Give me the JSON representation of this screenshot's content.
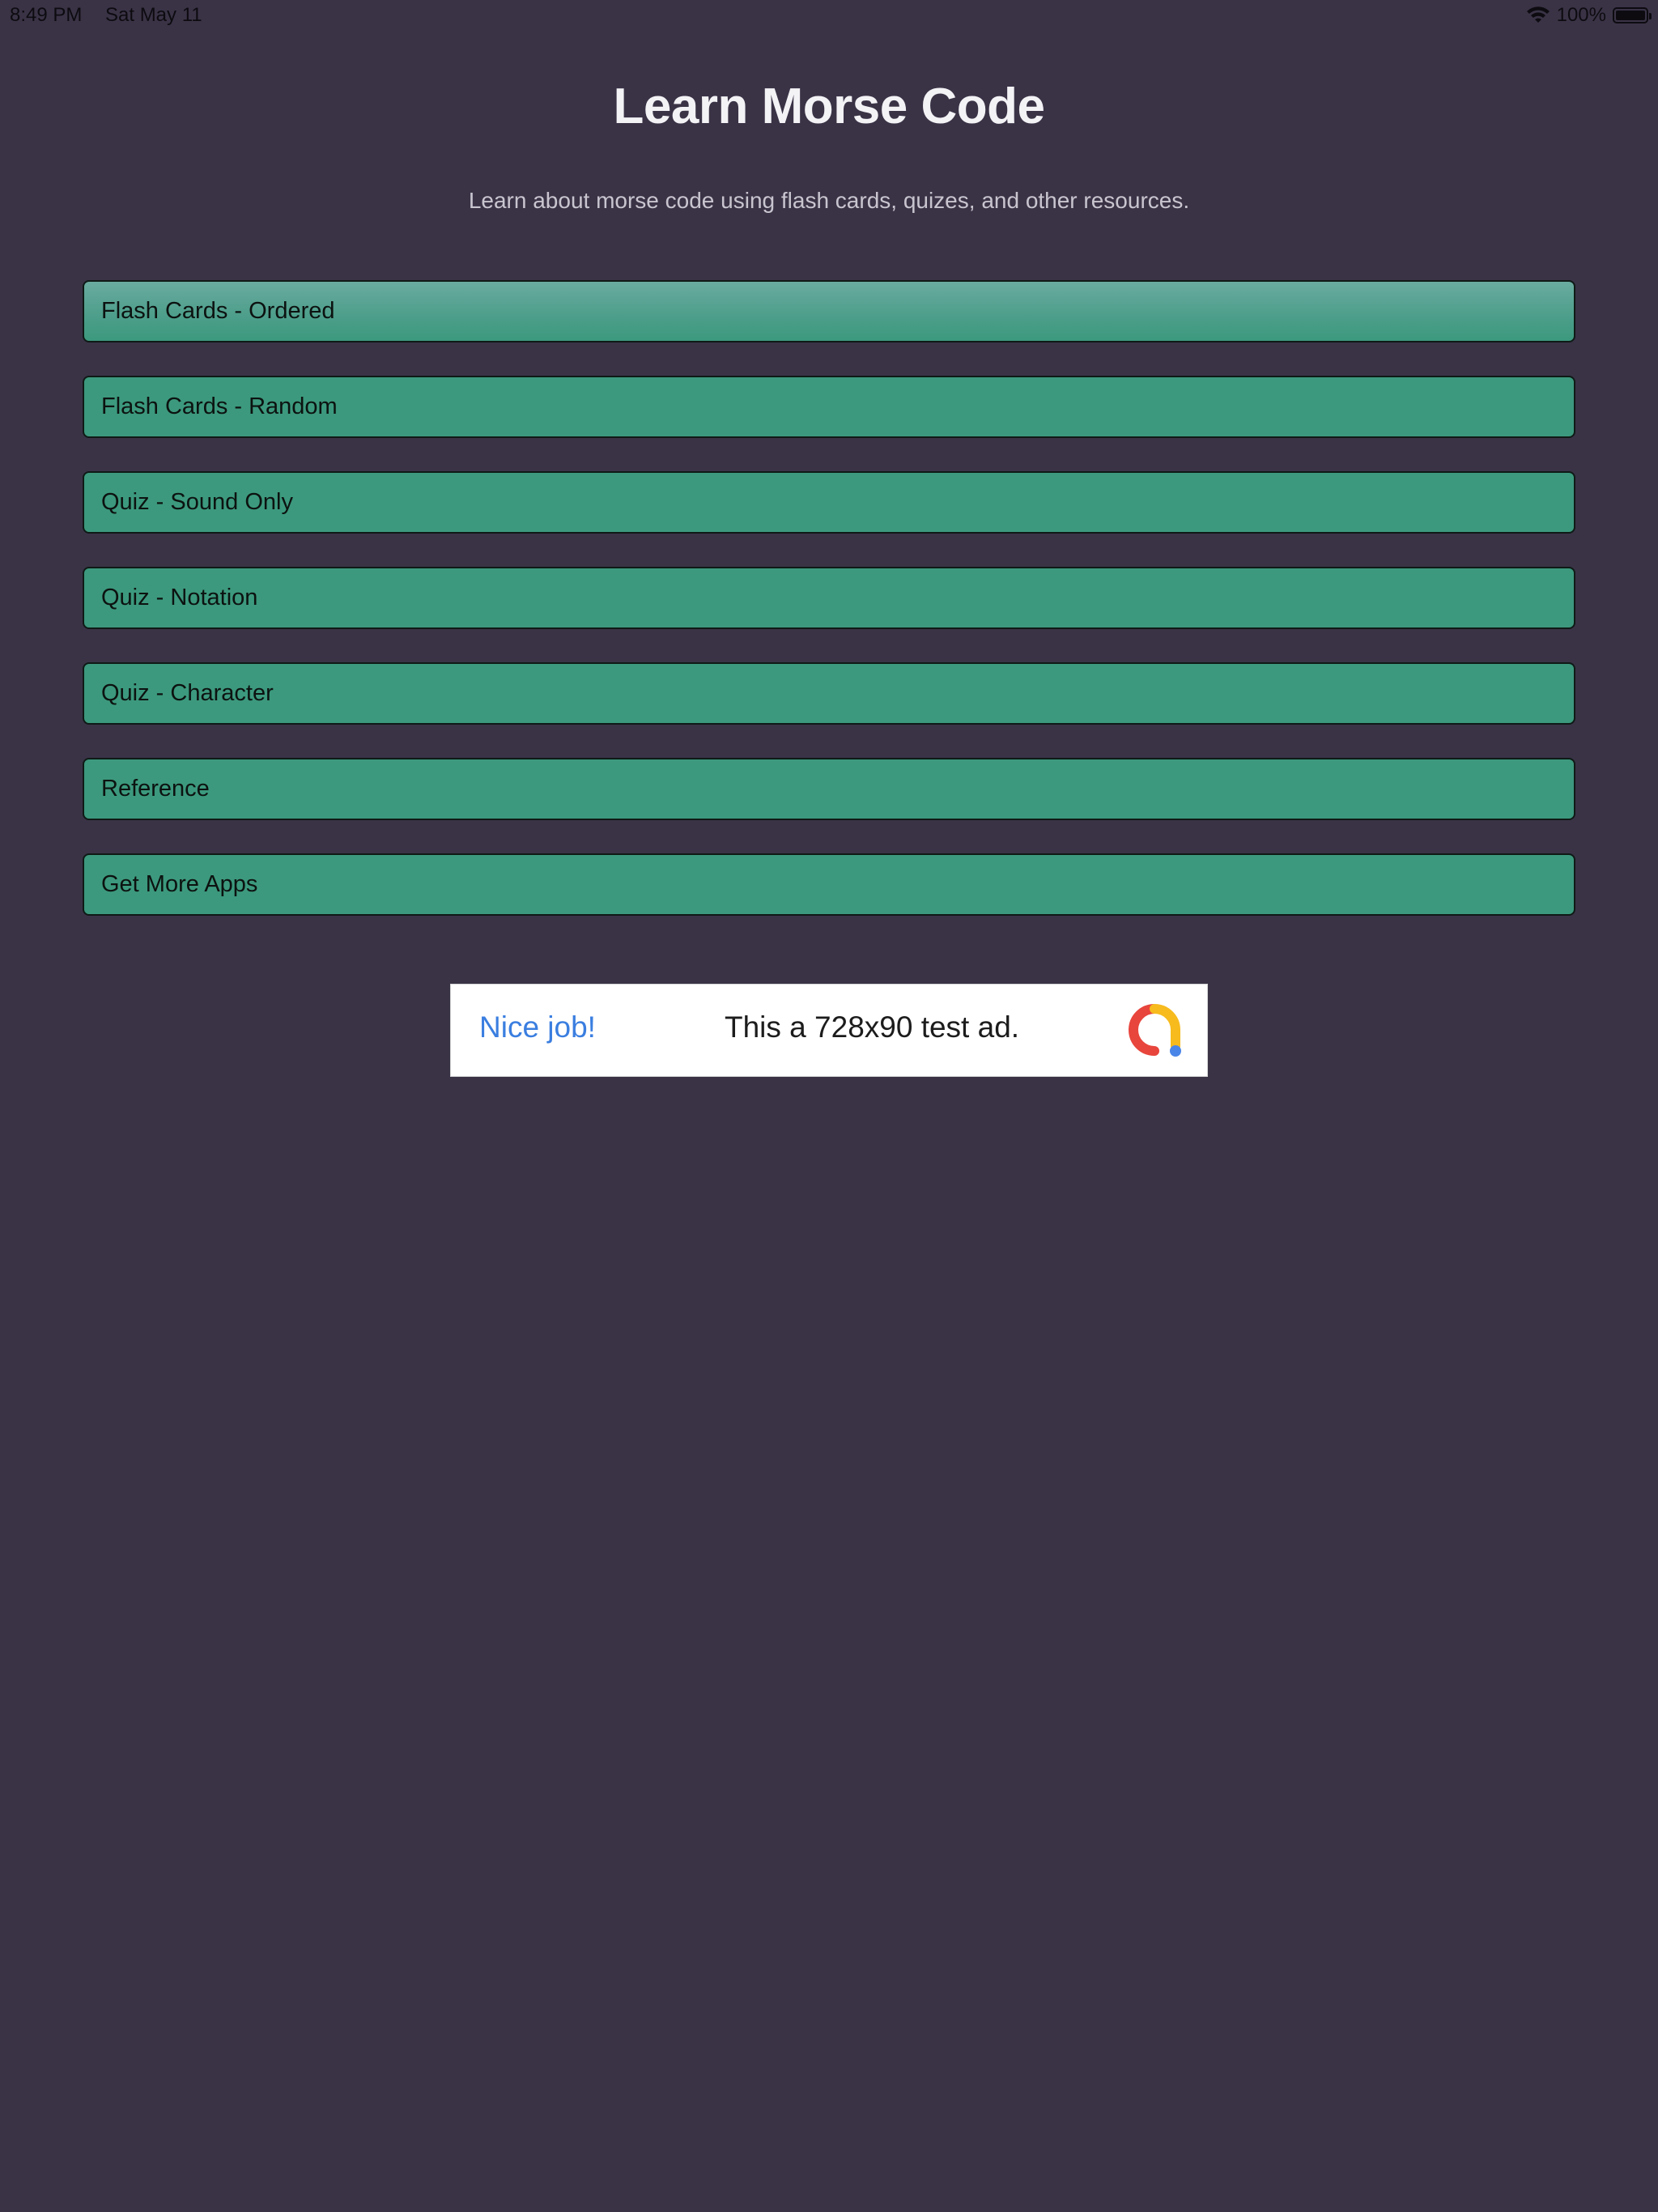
{
  "status_bar": {
    "time": "8:49 PM",
    "date": "Sat May 11",
    "battery": "100%",
    "wifi_icon": "wifi-icon",
    "battery_icon": "battery-icon"
  },
  "header": {
    "title": "Learn Morse Code",
    "subtitle": "Learn about morse code using flash cards, quizes, and other resources."
  },
  "menu": {
    "items": [
      {
        "label": "Flash Cards - Ordered"
      },
      {
        "label": "Flash Cards - Random"
      },
      {
        "label": "Quiz - Sound Only"
      },
      {
        "label": "Quiz - Notation"
      },
      {
        "label": "Quiz - Character"
      },
      {
        "label": "Reference"
      },
      {
        "label": "Get More Apps"
      }
    ],
    "button_color": "#3c997d"
  },
  "ad": {
    "heading": "Nice job!",
    "text": "This a 728x90 test ad.",
    "logo_icon": "ad-logo-icon"
  },
  "colors": {
    "background": "#3a3346",
    "title": "#f3f2f5",
    "ad_heading": "#3a7ee0"
  }
}
